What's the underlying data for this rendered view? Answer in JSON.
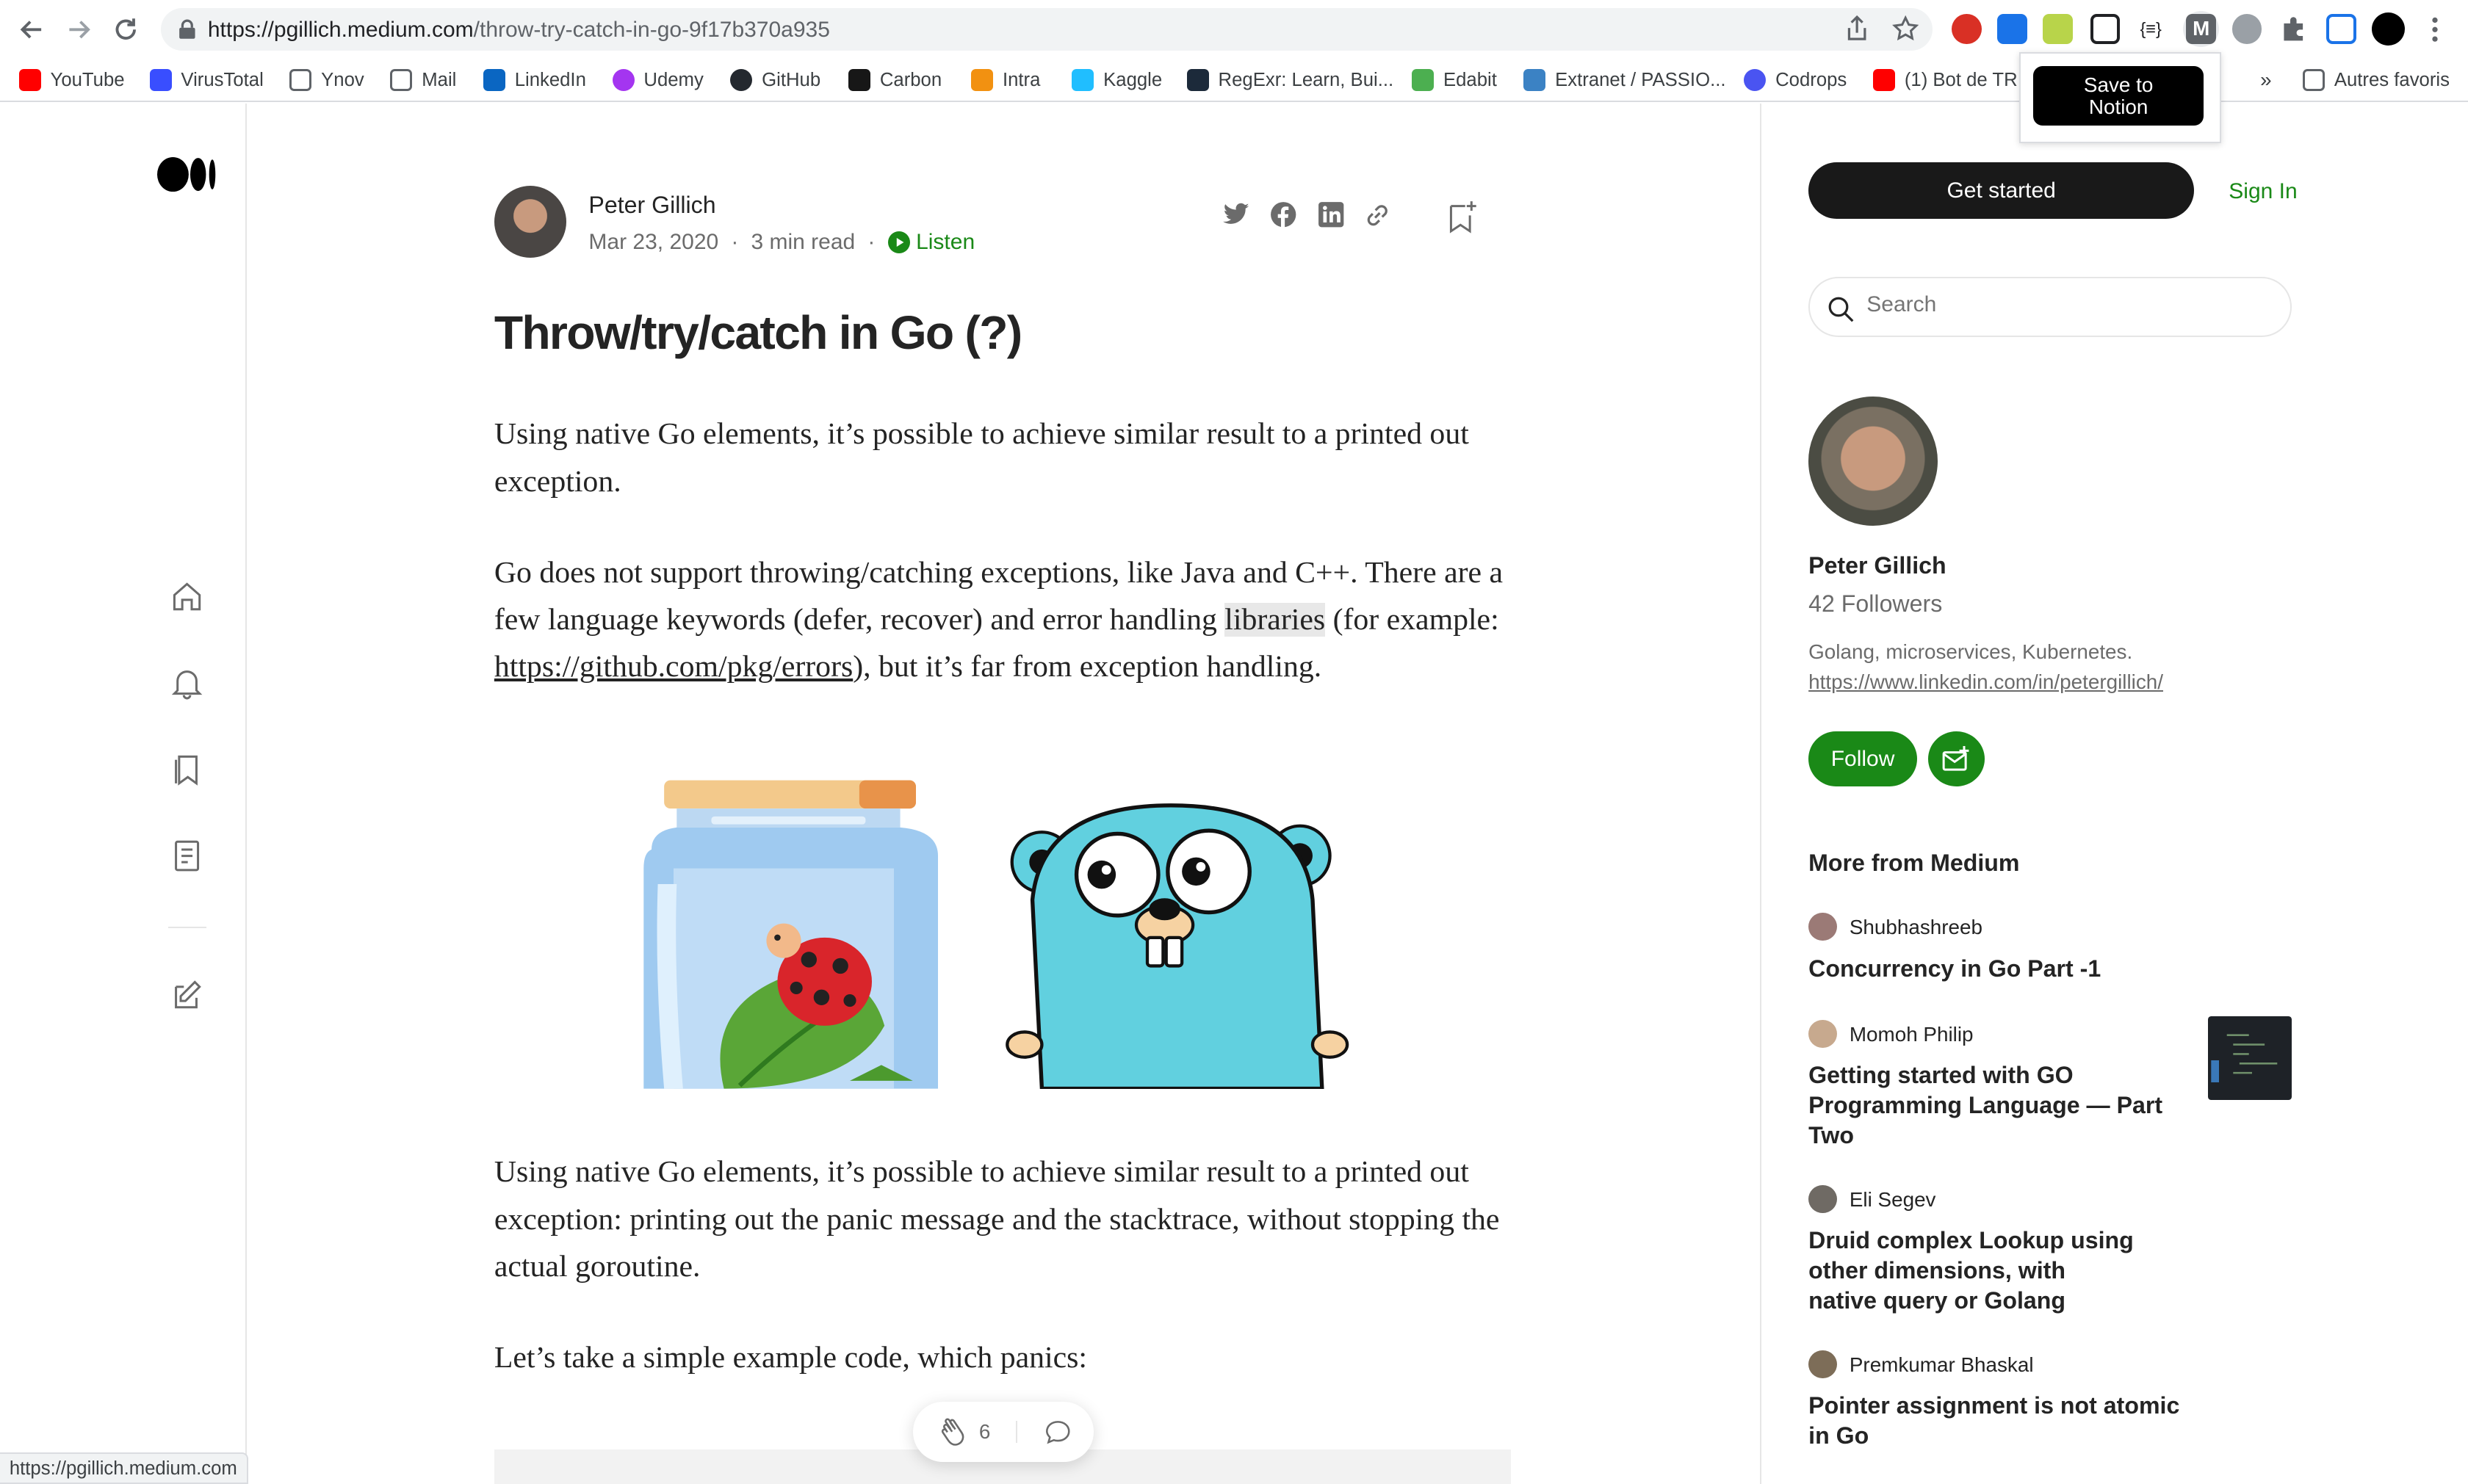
{
  "browser": {
    "url_host": "https://pgillich.medium.com",
    "url_path": "/throw-try-catch-in-go-9f17b370a935",
    "status_url": "https://pgillich.medium.com",
    "bookmarks": [
      "YouTube",
      "VirusTotal",
      "Ynov",
      "Mail",
      "LinkedIn",
      "Udemy",
      "GitHub",
      "Carbon",
      "Intra",
      "Kaggle",
      "RegExr: Learn, Bui...",
      "Edabit",
      "Extranet / PASSIO...",
      "Codrops",
      "(1) Bot de TR..."
    ],
    "more_bookmarks": "»",
    "other_bookmarks": "Autres favoris",
    "extension_popup": "Save to\nNotion"
  },
  "article": {
    "author": "Peter Gillich",
    "date": "Mar 23, 2020",
    "read_time": "3 min read",
    "listen": "Listen",
    "title": "Throw/try/catch in Go (?)",
    "p1": "Using native Go elements, it’s possible to achieve similar result to a printed out exception.",
    "p2_a": "Go does not support throwing/catching exceptions, like Java and C++. There are a few language keywords (defer, recover) and error handling ",
    "p2_hl": "libraries",
    "p2_b": " (for example: ",
    "p2_link": "https://github.com/pkg/errors",
    "p2_c": "), but it’s far from exception handling.",
    "p3": "Using native Go elements, it’s possible to achieve similar result to a printed out exception: printing out the panic message and the stacktrace, without stopping the actual goroutine.",
    "p4": "Let’s take a simple example code, which panics:",
    "clap_count": "6"
  },
  "sidebar": {
    "get_started": "Get started",
    "sign_in": "Sign In",
    "search_placeholder": "Search",
    "profile_name": "Peter Gillich",
    "followers": "42 Followers",
    "bio": "Golang, microservices, Kubernetes.",
    "bio_link": "https://www.linkedin.com/in/petergillich/",
    "follow": "Follow",
    "more_from": "More from Medium",
    "stories": [
      {
        "author": "Shubhashreeb",
        "title": "Concurrency in Go Part -1"
      },
      {
        "author": "Momoh Philip",
        "title": "Getting started with GO Programming Language — Part Two"
      },
      {
        "author": "Eli Segev",
        "title": "Druid complex Lookup using other dimensions, with native query or Golang"
      },
      {
        "author": "Premkumar Bhaskal",
        "title": "Pointer assignment is not atomic in Go"
      }
    ]
  },
  "colors": {
    "accent_green": "#1a8917",
    "follow_green": "#1a8917",
    "black_button": "#191919"
  }
}
